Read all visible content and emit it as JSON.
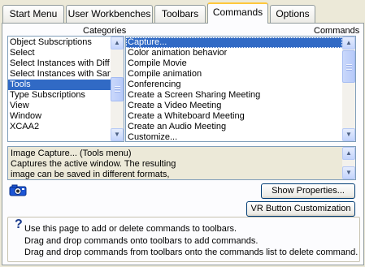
{
  "tabs": [
    {
      "label": "Start Menu",
      "active": false
    },
    {
      "label": "User Workbenches",
      "active": false
    },
    {
      "label": "Toolbars",
      "active": false
    },
    {
      "label": "Commands",
      "active": true
    },
    {
      "label": "Options",
      "active": false
    }
  ],
  "categories": {
    "header": "Categories",
    "items": [
      "Object Subscriptions",
      "Select",
      "Select Instances with Diff",
      "Select Instances with San",
      "Tools",
      "Type Subscriptions",
      "View",
      "Window",
      "XCAA2"
    ],
    "selected": "Tools"
  },
  "commands": {
    "header": "Commands",
    "items": [
      "Capture...",
      "Color animation behavior",
      "Compile Movie",
      "Compile animation",
      "Conferencing",
      "Create a Screen Sharing Meeting",
      "Create a Video Meeting",
      "Create a Whiteboard Meeting",
      "Create an Audio Meeting",
      "Customize..."
    ],
    "selected": "Capture..."
  },
  "description": {
    "lines": [
      "Image Capture... (Tools menu)",
      "Captures the active window. The resulting",
      "image can be saved in different formats,"
    ]
  },
  "command_icon": "camera-icon",
  "buttons": {
    "show_properties": "Show Properties...",
    "vr_customization": "VR Button Customization"
  },
  "hint": {
    "lines": [
      "Use this page to add or delete commands to toolbars.",
      "Drag and drop commands onto toolbars to add commands.",
      "Drag and drop commands from toolbars onto the commands list to delete command."
    ]
  },
  "colors": {
    "selection": "#316ac5",
    "active_tab_accent": "#ffc83c",
    "dialog_bg": "#ece9d8"
  }
}
